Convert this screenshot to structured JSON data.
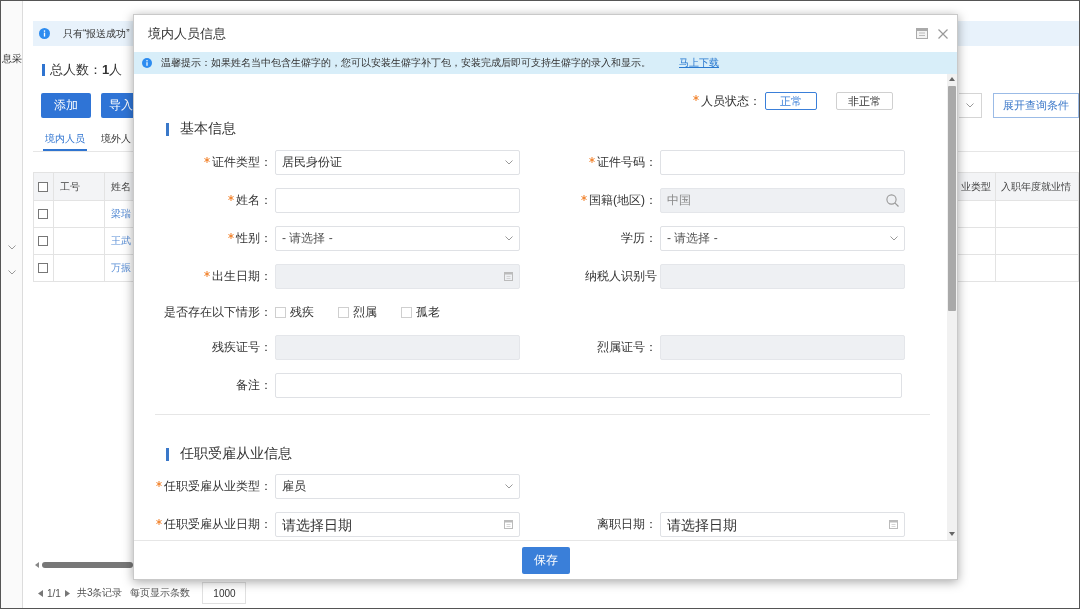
{
  "sidebar": {
    "label": "息采",
    "groups": [
      {
        "expanded": false
      },
      {
        "expanded": false
      }
    ]
  },
  "notice": {
    "text": "只有“报送成功”"
  },
  "summary": {
    "text": "总人数：**1**人"
  },
  "toolbar": {
    "buttons": [
      {
        "label": "添加"
      },
      {
        "label": "导入"
      }
    ],
    "expand_button": "展开查询条件"
  },
  "tabs": [
    {
      "label": "境内人员",
      "selected": true
    },
    {
      "label": "境外人",
      "selected": false
    }
  ],
  "table": {
    "select_all_checked": false,
    "columns": [
      "工号",
      "姓名",
      "业类型",
      "入职年度就业情"
    ],
    "rows": [
      {
        "checked": false,
        "name": "梁瑞"
      },
      {
        "checked": false,
        "name": "王武"
      },
      {
        "checked": false,
        "name": "万振"
      }
    ]
  },
  "pagination": {
    "page": "1/1",
    "total": "共3条记录",
    "page_size_label": "每页显示条数",
    "page_size": "1000"
  },
  "dialog": {
    "title": "境内人员信息",
    "notice": {
      "text": "温馨提示：如果姓名当中包含生僻字的，您可以安装生僻字补丁包，安装完成后即可支持生僻字的录入和显示。",
      "link": "马上下载"
    },
    "status": {
      "label": "人员状态：",
      "required": true,
      "options": [
        {
          "label": "正常",
          "selected": true
        },
        {
          "label": "非正常",
          "selected": false
        }
      ]
    },
    "sections": [
      {
        "title": "基本信息",
        "rows": [
          [
            {
              "kind": "select",
              "label": "证件类型：",
              "required": true,
              "value": "居民身份证"
            },
            {
              "kind": "input",
              "label": "证件号码：",
              "required": true,
              "disabled": false
            }
          ],
          [
            {
              "kind": "input",
              "label": "姓名：",
              "required": true,
              "disabled": false
            },
            {
              "kind": "search",
              "label": "国籍(地区)：",
              "required": true,
              "disabled": true,
              "value": "中国"
            }
          ],
          [
            {
              "kind": "select",
              "label": "性别：",
              "required": true,
              "placeholder": "- 请选择 -"
            },
            {
              "kind": "select",
              "label": "学历：",
              "required": false,
              "placeholder": "- 请选择 -"
            }
          ],
          [
            {
              "kind": "date",
              "label": "出生日期：",
              "required": true,
              "disabled": true
            },
            {
              "kind": "input",
              "label": "纳税人识别号",
              "required": false,
              "disabled": true
            }
          ],
          [
            {
              "kind": "checks",
              "label": "是否存在以下情形：",
              "required": false,
              "options": [
                {
                  "label": "残疾",
                  "checked": false
                },
                {
                  "label": "烈属",
                  "checked": false
                },
                {
                  "label": "孤老",
                  "checked": false
                }
              ]
            }
          ],
          [
            {
              "kind": "input",
              "label": "残疾证号：",
              "required": false,
              "disabled": true
            },
            {
              "kind": "input",
              "label": "烈属证号：",
              "required": false,
              "disabled": true
            }
          ],
          [
            {
              "kind": "wide",
              "label": "备注：",
              "required": false,
              "disabled": false
            }
          ]
        ]
      },
      {
        "title": "任职受雇从业信息",
        "rows": [
          [
            {
              "kind": "select",
              "label": "任职受雇从业类型：",
              "required": true,
              "value": "雇员"
            }
          ],
          [
            {
              "kind": "date",
              "label": "任职受雇从业日期：",
              "required": true,
              "disabled": false,
              "placeholder": "请选择日期"
            },
            {
              "kind": "date",
              "label": "离职日期：",
              "required": false,
              "disabled": false,
              "placeholder": "请选择日期"
            }
          ]
        ]
      }
    ],
    "save_button": "保存"
  }
}
